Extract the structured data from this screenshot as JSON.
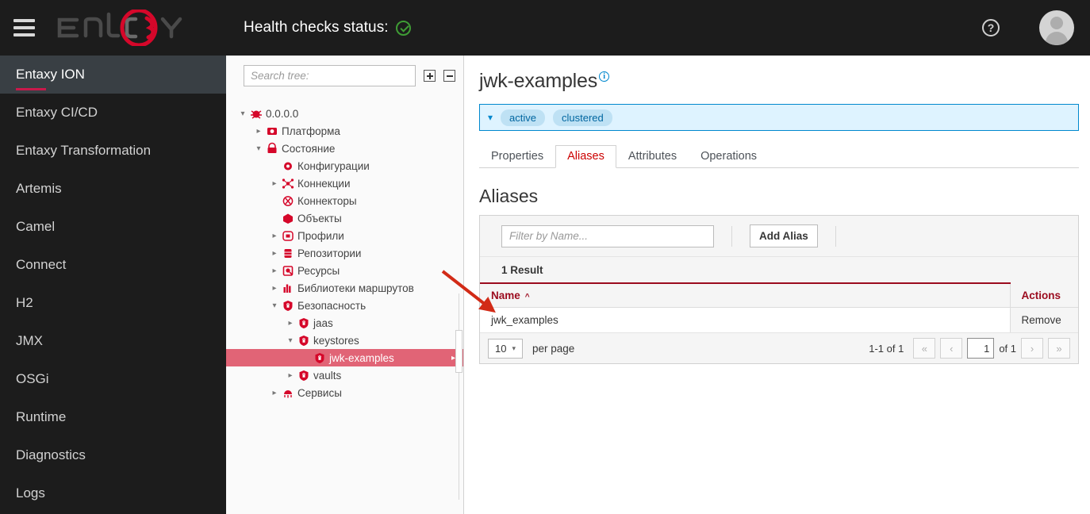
{
  "topbar": {
    "menu_icon": "hamburger-icon",
    "logo_text": "ENTAXY",
    "health_label": "Health checks status:",
    "health_status_icon": "check-circle-icon",
    "help_icon": "question-circle-icon",
    "help_glyph": "?",
    "avatar_icon": "user-avatar-icon"
  },
  "sidebar": {
    "items": [
      {
        "label": "Entaxy ION",
        "active": true
      },
      {
        "label": "Entaxy CI/CD",
        "active": false
      },
      {
        "label": "Entaxy Transformation",
        "active": false
      },
      {
        "label": "Artemis",
        "active": false
      },
      {
        "label": "Camel",
        "active": false
      },
      {
        "label": "Connect",
        "active": false
      },
      {
        "label": "H2",
        "active": false
      },
      {
        "label": "JMX",
        "active": false
      },
      {
        "label": "OSGi",
        "active": false
      },
      {
        "label": "Runtime",
        "active": false
      },
      {
        "label": "Diagnostics",
        "active": false
      },
      {
        "label": "Logs",
        "active": false
      }
    ]
  },
  "tree": {
    "search_placeholder": "Search tree:",
    "search_value": "",
    "expand_all_icon": "expand-all-icon",
    "collapse_all_icon": "collapse-all-icon",
    "nodes": [
      {
        "label": "0.0.0.0",
        "indent": 0,
        "caret": "down",
        "icon": "bug-icon",
        "selected": false
      },
      {
        "label": "Платформа",
        "indent": 1,
        "caret": "right",
        "icon": "camera-icon",
        "selected": false
      },
      {
        "label": "Состояние",
        "indent": 1,
        "caret": "down",
        "icon": "lock-icon",
        "selected": false
      },
      {
        "label": "Конфигурации",
        "indent": 2,
        "caret": "none",
        "icon": "gear-icon",
        "selected": false
      },
      {
        "label": "Коннекции",
        "indent": 2,
        "caret": "right",
        "icon": "network-icon",
        "selected": false
      },
      {
        "label": "Коннекторы",
        "indent": 2,
        "caret": "none",
        "icon": "connector-icon",
        "selected": false
      },
      {
        "label": "Объекты",
        "indent": 2,
        "caret": "none",
        "icon": "cube-icon",
        "selected": false
      },
      {
        "label": "Профили",
        "indent": 2,
        "caret": "right",
        "icon": "profile-icon",
        "selected": false
      },
      {
        "label": "Репозитории",
        "indent": 2,
        "caret": "right",
        "icon": "database-icon",
        "selected": false
      },
      {
        "label": "Ресурсы",
        "indent": 2,
        "caret": "right",
        "icon": "resource-icon",
        "selected": false
      },
      {
        "label": "Библиотеки маршрутов",
        "indent": 2,
        "caret": "right",
        "icon": "chart-icon",
        "selected": false
      },
      {
        "label": "Безопасность",
        "indent": 2,
        "caret": "down",
        "icon": "shield-icon",
        "selected": false
      },
      {
        "label": "jaas",
        "indent": 3,
        "caret": "right",
        "icon": "shield-icon",
        "selected": false
      },
      {
        "label": "keystores",
        "indent": 3,
        "caret": "down",
        "icon": "shield-icon",
        "selected": false
      },
      {
        "label": "jwk-examples",
        "indent": 4,
        "caret": "none",
        "icon": "shield-icon",
        "selected": true
      },
      {
        "label": "vaults",
        "indent": 3,
        "caret": "right",
        "icon": "shield-icon",
        "selected": false
      },
      {
        "label": "Сервисы",
        "indent": 2,
        "caret": "right",
        "icon": "service-icon",
        "selected": false
      }
    ]
  },
  "main": {
    "page_title": "jwk-examples",
    "page_title_info_icon": "info-circle-icon",
    "page_title_info_glyph": "i",
    "alert": {
      "caret_icon": "chevron-down-icon",
      "pills": [
        "active",
        "clustered"
      ]
    },
    "tabs": [
      {
        "label": "Properties",
        "active": false
      },
      {
        "label": "Aliases",
        "active": true
      },
      {
        "label": "Attributes",
        "active": false
      },
      {
        "label": "Operations",
        "active": false
      }
    ],
    "section_title": "Aliases",
    "toolbar": {
      "filter_placeholder": "Filter by Name...",
      "filter_value": "",
      "add_alias_label": "Add Alias"
    },
    "result_count": "1 Result",
    "table": {
      "columns": [
        "Name",
        "Actions"
      ],
      "sort_icon": "caret-up-icon",
      "rows": [
        {
          "name": "jwk_examples",
          "action": "Remove"
        }
      ]
    },
    "pager": {
      "per_page_value": "10",
      "per_page_label": "per page",
      "per_page_chevron": "chevron-down-icon",
      "range_text": "1-1 of 1",
      "first_icon": "«",
      "prev_icon": "‹",
      "page_value": "1",
      "of_label": "of 1",
      "next_icon": "›",
      "last_icon": "»"
    }
  },
  "colors": {
    "topbar_bg": "#1c1c1c",
    "sidebar_active_bg": "#393f44",
    "brand_red": "#c9194b",
    "tree_selected_bg": "#e16476",
    "tab_active_text": "#cc0000",
    "table_header_text": "#9b0b1e",
    "alert_border": "#0088ce",
    "alert_bg": "#def3ff",
    "annotation_arrow": "#d22b17",
    "health_ok": "#3f9c35"
  }
}
